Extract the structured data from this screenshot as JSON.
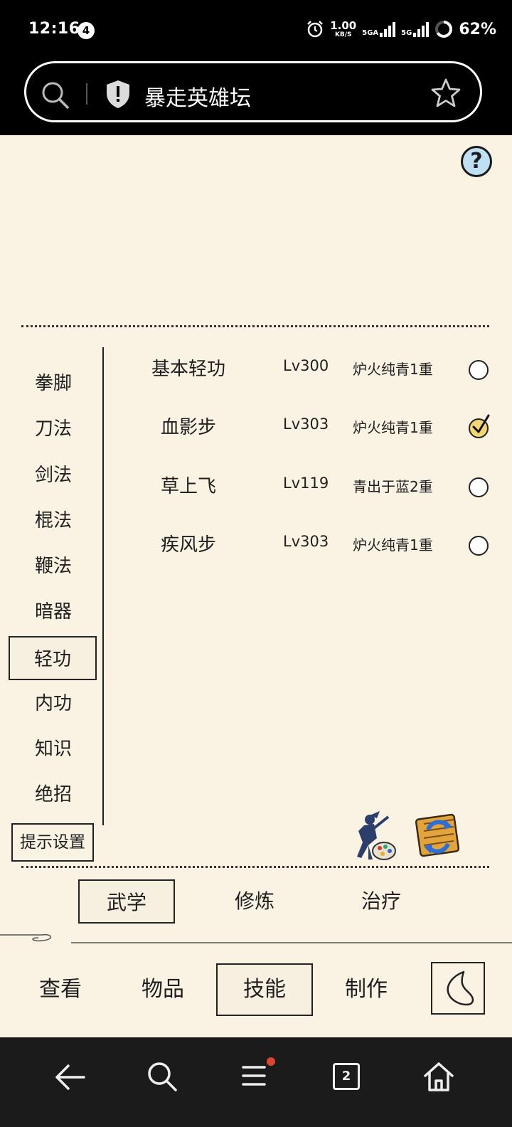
{
  "status_bar": {
    "time": "12:16",
    "notification_count": "4",
    "net_speed_value": "1.00",
    "net_speed_unit": "KB/S",
    "sim1_label": "5GA",
    "sim2_label": "5G",
    "battery": "62%"
  },
  "address_bar": {
    "title": "暴走英雄坛"
  },
  "help": {
    "label": "?"
  },
  "categories": [
    {
      "label": "拳脚",
      "active": false
    },
    {
      "label": "刀法",
      "active": false
    },
    {
      "label": "剑法",
      "active": false
    },
    {
      "label": "棍法",
      "active": false
    },
    {
      "label": "鞭法",
      "active": false
    },
    {
      "label": "暗器",
      "active": false
    },
    {
      "label": "轻功",
      "active": true
    },
    {
      "label": "内功",
      "active": false
    },
    {
      "label": "知识",
      "active": false
    },
    {
      "label": "绝招",
      "active": false
    }
  ],
  "skills": [
    {
      "name": "基本轻功",
      "level": "Lv300",
      "rank": "炉火纯青1重",
      "checked": false
    },
    {
      "name": "血影步",
      "level": "Lv303",
      "rank": "炉火纯青1重",
      "checked": true
    },
    {
      "name": "草上飞",
      "level": "Lv119",
      "rank": "青出于蓝2重",
      "checked": false
    },
    {
      "name": "疾风步",
      "level": "Lv303",
      "rank": "炉火纯青1重",
      "checked": false
    }
  ],
  "hint_button": "提示设置",
  "sub_tabs": [
    {
      "label": "武学",
      "active": true
    },
    {
      "label": "修炼",
      "active": false
    },
    {
      "label": "治疗",
      "active": false
    }
  ],
  "main_tabs": [
    {
      "label": "查看",
      "active": false
    },
    {
      "label": "物品",
      "active": false
    },
    {
      "label": "技能",
      "active": true
    },
    {
      "label": "制作",
      "active": false
    }
  ],
  "nav": {
    "tab_count": "2"
  }
}
